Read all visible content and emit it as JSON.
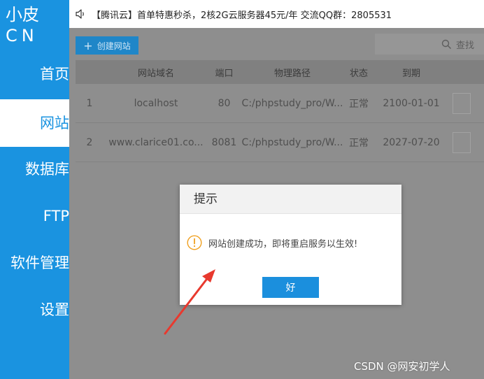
{
  "sidebar": {
    "brand_line1": "小皮",
    "brand_line2": "CN",
    "items": [
      {
        "label": "首页"
      },
      {
        "label": "网站"
      },
      {
        "label": "数据库"
      },
      {
        "label": "FTP"
      },
      {
        "label": "软件管理"
      },
      {
        "label": "设置"
      }
    ]
  },
  "notice": {
    "text": "【腾讯云】首单特惠秒杀，2核2G云服务器45元/年 交流QQ群：2805531"
  },
  "toolbar": {
    "create_label": "创建网站",
    "search_label": "查找"
  },
  "table": {
    "headers": [
      "网站域名",
      "端口",
      "物理路径",
      "状态",
      "到期"
    ],
    "rows": [
      {
        "idx": "1",
        "domain": "localhost",
        "port": "80",
        "path": "C:/phpstudy_pro/W...",
        "status": "正常",
        "expire": "2100-01-01"
      },
      {
        "idx": "2",
        "domain": "www.clarice01.co...",
        "port": "8081",
        "path": "C:/phpstudy_pro/W...",
        "status": "正常",
        "expire": "2027-07-20"
      }
    ]
  },
  "dialog": {
    "title": "提示",
    "message": "网站创建成功，即将重启服务以生效!",
    "ok_label": "好"
  },
  "watermark": "CSDN @网安初学人",
  "colors": {
    "sidebar": "#1a93e0",
    "primary_button": "#1b8fdd",
    "warning_icon": "#f0a020",
    "annotation_arrow": "#e8392e"
  }
}
